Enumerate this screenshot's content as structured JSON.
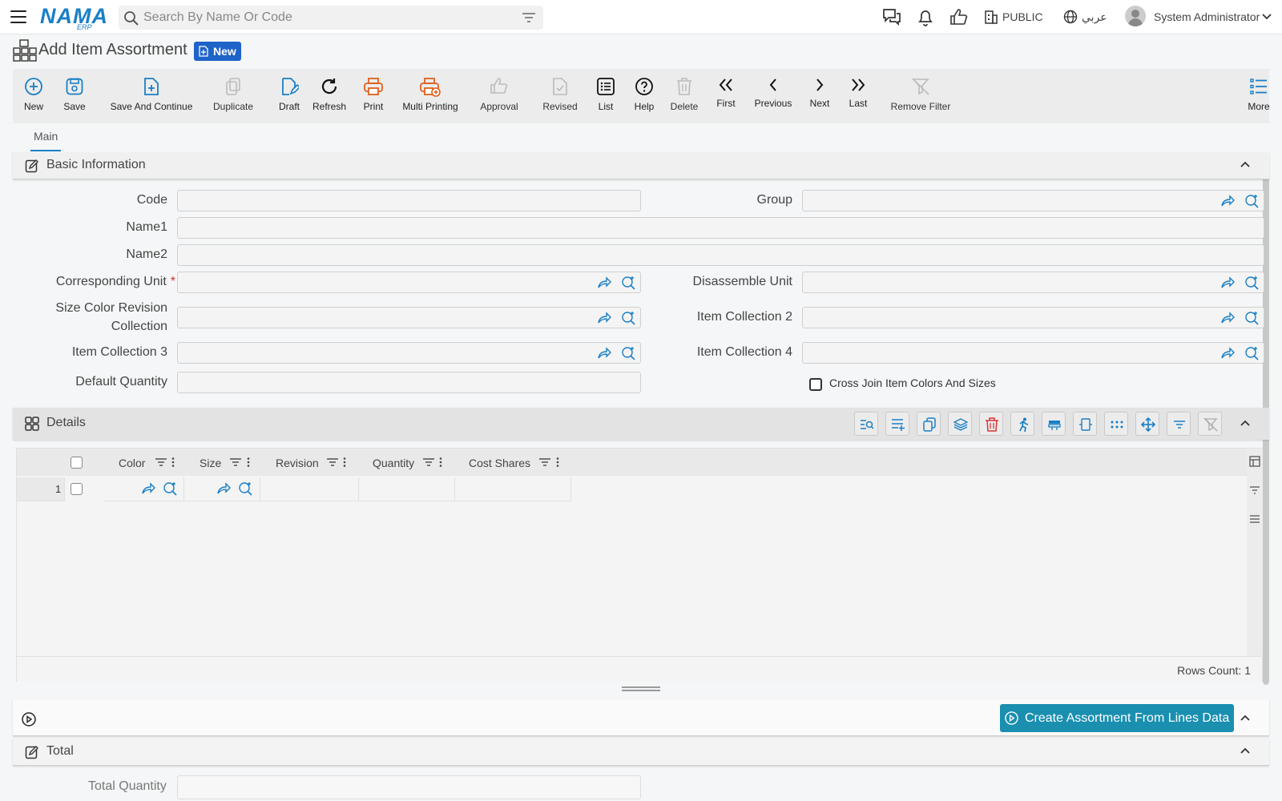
{
  "header": {
    "logo": "NAMA",
    "logo_sub": "ERP",
    "search_placeholder": "Search By Name Or Code",
    "company": "PUBLIC",
    "language": "عربي",
    "user": "System Administrator"
  },
  "page": {
    "title": "Add Item Assortment",
    "badge": "New"
  },
  "toolbar": {
    "new": "New",
    "save": "Save",
    "save_continue": "Save And Continue",
    "duplicate": "Duplicate",
    "draft": "Draft",
    "refresh": "Refresh",
    "print": "Print",
    "multi_printing": "Multi Printing",
    "approval": "Approval",
    "revised": "Revised",
    "list": "List",
    "help": "Help",
    "delete": "Delete",
    "first": "First",
    "previous": "Previous",
    "next": "Next",
    "last": "Last",
    "remove_filter": "Remove Filter",
    "more": "More"
  },
  "tabs": [
    "Main"
  ],
  "basic": {
    "title": "Basic Information",
    "code": "Code",
    "group": "Group",
    "name1": "Name1",
    "name2": "Name2",
    "corresponding_unit": "Corresponding Unit",
    "required_mark": "*",
    "disassemble_unit": "Disassemble Unit",
    "size_color_rev": "Size Color Revision Collection",
    "item_collection_2": "Item Collection 2",
    "item_collection_3": "Item Collection 3",
    "item_collection_4": "Item Collection 4",
    "default_quantity": "Default Quantity",
    "cross_join": "Cross Join Item Colors And Sizes"
  },
  "details": {
    "title": "Details",
    "columns": [
      "Color",
      "Size",
      "Revision",
      "Quantity",
      "Cost Shares"
    ],
    "row_number": "1",
    "rows_count": "Rows Count: 1"
  },
  "actions": {
    "create_assortment": "Create Assortment From Lines Data"
  },
  "total": {
    "title": "Total",
    "total_quantity": "Total Quantity"
  },
  "colors": {
    "accent": "#1a7fc6",
    "orange": "#e0601c",
    "action_button": "#1a8fb0",
    "badge": "#1e63c8",
    "delete_red": "#d33"
  }
}
